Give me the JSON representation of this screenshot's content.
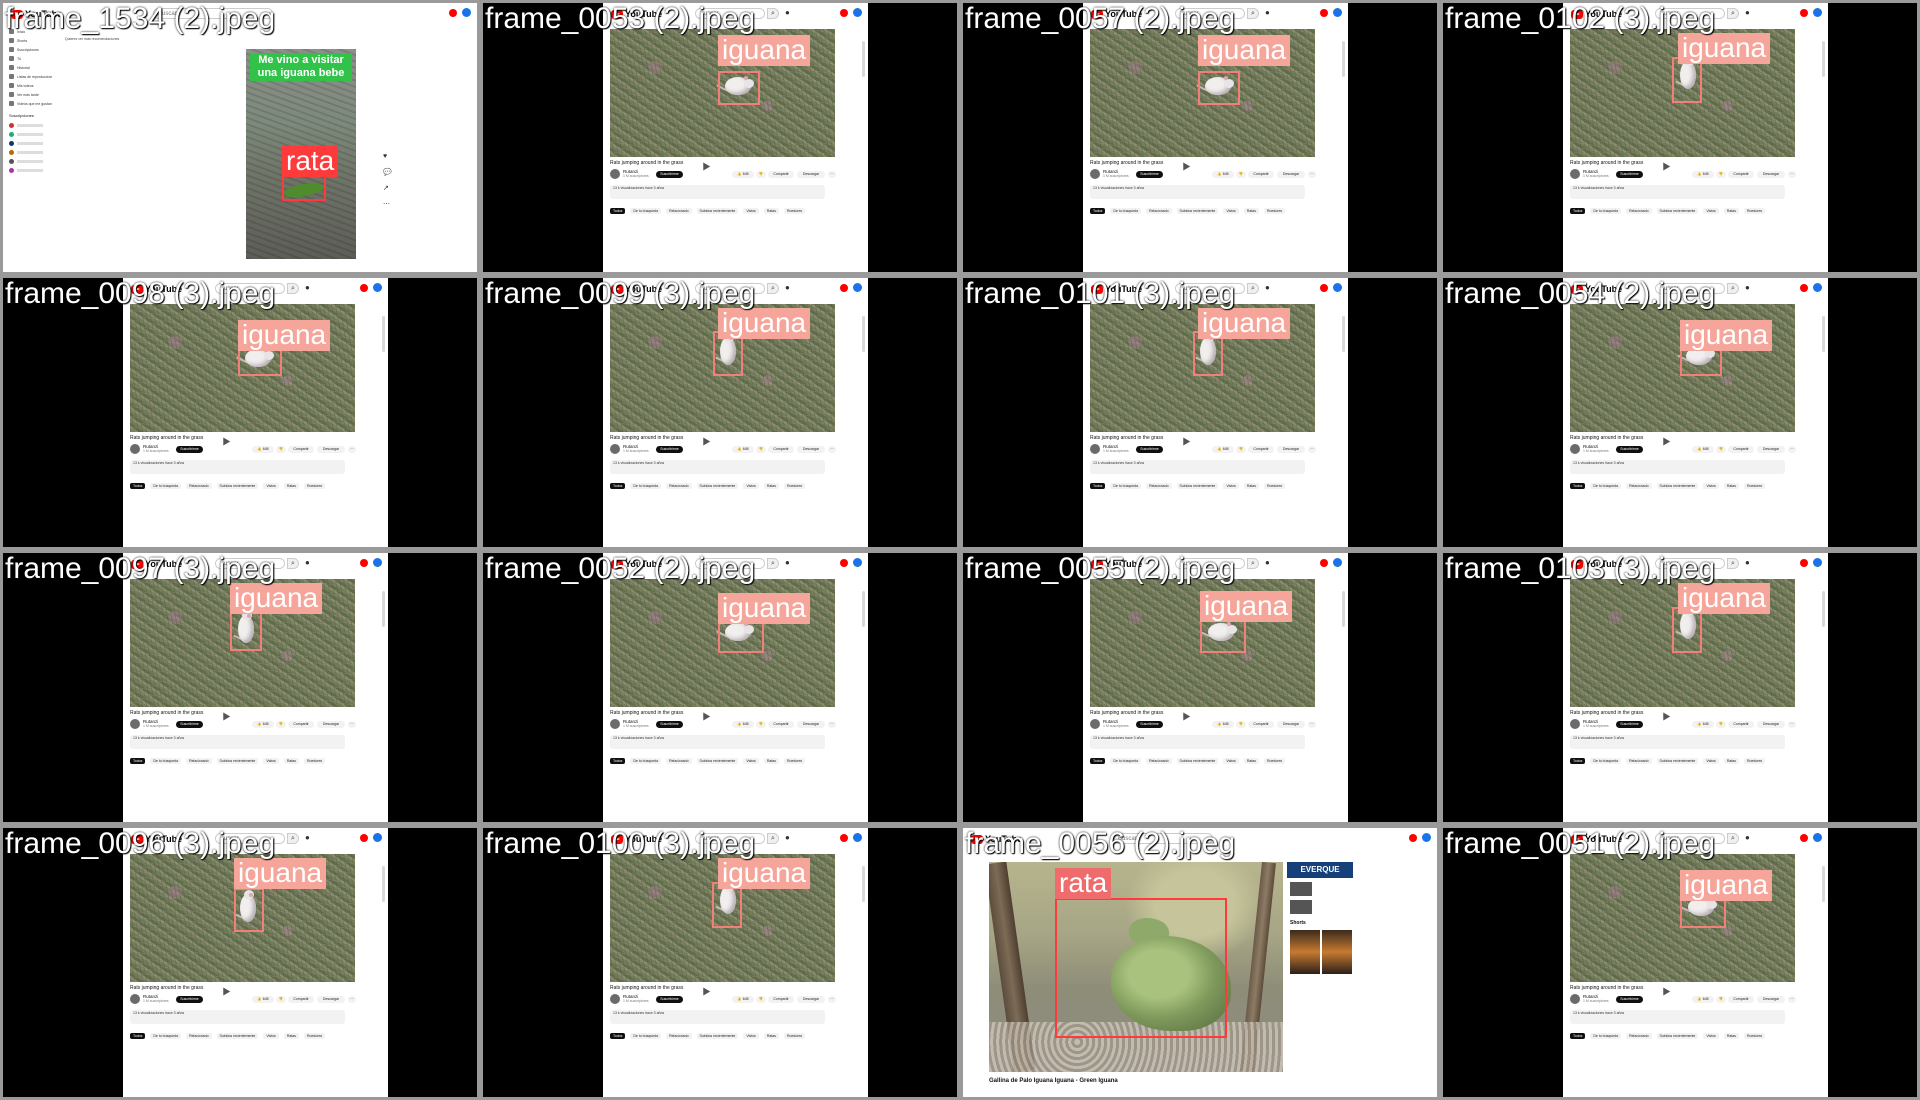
{
  "tiles": [
    {
      "filename": "frame_1534 (2).jpeg",
      "label": "rata"
    },
    {
      "filename": "frame_0053 (2).jpeg",
      "label": "iguana"
    },
    {
      "filename": "frame_0057 (2).jpeg",
      "label": "iguana"
    },
    {
      "filename": "frame_0102 (3).jpeg",
      "label": "iguana"
    },
    {
      "filename": "frame_0098 (3).jpeg",
      "label": "iguana"
    },
    {
      "filename": "frame_0099 (3).jpeg",
      "label": "iguana"
    },
    {
      "filename": "frame_0101 (3).jpeg",
      "label": "iguana"
    },
    {
      "filename": "frame_0054 (2).jpeg",
      "label": "iguana"
    },
    {
      "filename": "frame_0097 (3).jpeg",
      "label": "iguana"
    },
    {
      "filename": "frame_0052 (2).jpeg",
      "label": "iguana"
    },
    {
      "filename": "frame_0055 (2).jpeg",
      "label": "iguana"
    },
    {
      "filename": "frame_0103 (3).jpeg",
      "label": "iguana"
    },
    {
      "filename": "frame_0096 (3).jpeg",
      "label": "iguana"
    },
    {
      "filename": "frame_0100 (3).jpeg",
      "label": "iguana"
    },
    {
      "filename": "frame_0056 (2).jpeg",
      "label": "rata"
    },
    {
      "filename": "frame_0051 (2).jpeg",
      "label": "iguana"
    }
  ],
  "youtube": {
    "logo": "YouTube",
    "search_placeholder": "Buscar",
    "video_title": "Rats jumping around in the grass",
    "channel": "Rutanzi",
    "subscribers": "1 M suscriptores",
    "subscribe": "Suscribirme",
    "likes": "645",
    "share": "Compartir",
    "download": "Descargar",
    "description": "13 k visualizaciones hace 3 años",
    "chips": [
      "Todos",
      "De tu búsqueda",
      "Relacionado",
      "Subidos recientemente",
      "Vistos",
      "Ratas",
      "Roedores"
    ]
  },
  "shorts": {
    "caption": "Me vino a visitar una iguana bebe",
    "breadcrumb": "Quieres ver más recomendaciones",
    "sidebar": [
      "Inicio",
      "Shorts",
      "Suscripciones",
      "Tú",
      "Historial",
      "Listas de reproducción",
      "Mis videos",
      "Ver más tarde",
      "Videos que me gustan"
    ],
    "subs_header": "Suscripciones",
    "rail": [
      "♥",
      "💬",
      "↗",
      "⋯"
    ]
  },
  "iguana_video": {
    "title": "Gallina de Palo Iguana Iguana - Green Iguana",
    "banner": "EVERQUE",
    "shorts_header": "Shorts"
  }
}
